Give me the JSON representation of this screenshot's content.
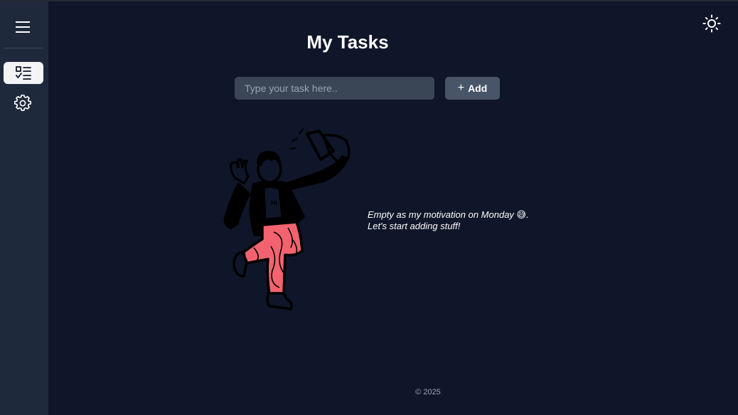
{
  "app": {
    "title": "My Tasks"
  },
  "sidebar": {
    "menu_icon": "hamburger-menu-icon",
    "items": [
      {
        "icon": "checklist-icon",
        "active": true
      },
      {
        "icon": "gear-icon",
        "active": false
      }
    ]
  },
  "header": {
    "theme_icon": "sun-icon"
  },
  "task_form": {
    "placeholder": "Type your task here..",
    "value": "",
    "add_label": "Add",
    "add_icon": "plus-icon"
  },
  "empty_state": {
    "line1": "Empty as my motivation on Monday 😅.",
    "line2": "Let's start adding stuff!",
    "illustration": "person-taking-selfie-illustration"
  },
  "footer": {
    "copyright": "© 2025"
  },
  "colors": {
    "background": "#0f1629",
    "sidebar": "#1e293b",
    "input": "#3a4555",
    "button": "#485569",
    "accent_pants": "#f2636f"
  }
}
